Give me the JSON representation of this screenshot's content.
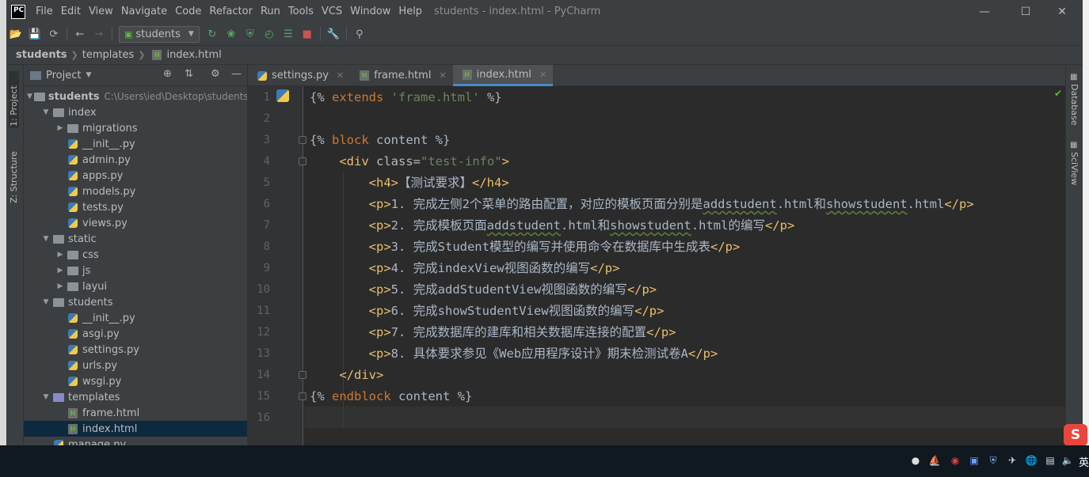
{
  "app": {
    "logo": "PC",
    "window_title": "students - index.html - PyCharm",
    "menu": [
      "File",
      "Edit",
      "View",
      "Navigate",
      "Code",
      "Refactor",
      "Run",
      "Tools",
      "VCS",
      "Window",
      "Help"
    ],
    "window_controls": {
      "minimize": "—",
      "maximize": "☐",
      "close": "✕"
    }
  },
  "toolbar": {
    "run_config": "students"
  },
  "breadcrumb": [
    "students",
    "templates",
    "index.html"
  ],
  "left_stripe": {
    "project_tab": "1: Project",
    "structure_tab": "Z: Structure"
  },
  "right_stripe": {
    "database_tab": "Database",
    "sciview_tab": "SciView"
  },
  "project_panel": {
    "title": "Project",
    "tree": [
      {
        "label": "students",
        "path": "C:\\Users\\ied\\Desktop\\students",
        "type": "folder",
        "depth": 0,
        "expanded": true,
        "bold": true
      },
      {
        "label": "index",
        "type": "folder",
        "depth": 1,
        "expanded": true
      },
      {
        "label": "migrations",
        "type": "folder",
        "depth": 2,
        "expanded": false
      },
      {
        "label": "__init__.py",
        "type": "py",
        "depth": 2
      },
      {
        "label": "admin.py",
        "type": "py",
        "depth": 2
      },
      {
        "label": "apps.py",
        "type": "py",
        "depth": 2
      },
      {
        "label": "models.py",
        "type": "py",
        "depth": 2
      },
      {
        "label": "tests.py",
        "type": "py",
        "depth": 2
      },
      {
        "label": "views.py",
        "type": "py",
        "depth": 2
      },
      {
        "label": "static",
        "type": "folder",
        "depth": 1,
        "expanded": true
      },
      {
        "label": "css",
        "type": "folder",
        "depth": 2,
        "expanded": false
      },
      {
        "label": "js",
        "type": "folder",
        "depth": 2,
        "expanded": false
      },
      {
        "label": "layui",
        "type": "folder",
        "depth": 2,
        "expanded": false
      },
      {
        "label": "students",
        "type": "folder",
        "depth": 1,
        "expanded": true
      },
      {
        "label": "__init__.py",
        "type": "py",
        "depth": 2
      },
      {
        "label": "asgi.py",
        "type": "py",
        "depth": 2
      },
      {
        "label": "settings.py",
        "type": "py",
        "depth": 2
      },
      {
        "label": "urls.py",
        "type": "py",
        "depth": 2
      },
      {
        "label": "wsgi.py",
        "type": "py",
        "depth": 2
      },
      {
        "label": "templates",
        "type": "folder-blue",
        "depth": 1,
        "expanded": true
      },
      {
        "label": "frame.html",
        "type": "html",
        "depth": 2
      },
      {
        "label": "index.html",
        "type": "html",
        "depth": 2,
        "selected": true
      },
      {
        "label": "manage.py",
        "type": "py",
        "depth": 1
      }
    ]
  },
  "editor_tabs": [
    {
      "label": "settings.py",
      "type": "py",
      "active": false
    },
    {
      "label": "frame.html",
      "type": "html",
      "active": false
    },
    {
      "label": "index.html",
      "type": "html",
      "active": true
    }
  ],
  "editor": {
    "lines": [
      [
        [
          "{% ",
          "tx"
        ],
        [
          "extends ",
          "kw"
        ],
        [
          "'frame.html'",
          "str"
        ],
        [
          " %}",
          "tx"
        ]
      ],
      [],
      [
        [
          "{% ",
          "tx"
        ],
        [
          "block ",
          "kw"
        ],
        [
          "content",
          "tx"
        ],
        [
          " %}",
          "tx"
        ]
      ],
      [
        [
          "    ",
          "tx"
        ],
        [
          "<div ",
          "tag"
        ],
        [
          "class=",
          "attr"
        ],
        [
          "\"test-info\"",
          "str"
        ],
        [
          ">",
          "tag"
        ]
      ],
      [
        [
          "        ",
          "tx"
        ],
        [
          "<h4>",
          "tag"
        ],
        [
          "【测试要求】",
          "tx"
        ],
        [
          "</h4>",
          "tag"
        ]
      ],
      [
        [
          "        ",
          "tx"
        ],
        [
          "<p>",
          "tag"
        ],
        [
          "1. 完成左侧2个菜单的路由配置，对应的模板页面分别是",
          "tx"
        ],
        [
          "addstudent",
          "ul"
        ],
        [
          ".html和",
          "tx"
        ],
        [
          "showstudent",
          "ul"
        ],
        [
          ".html",
          "tx"
        ],
        [
          "</p>",
          "tag"
        ]
      ],
      [
        [
          "        ",
          "tx"
        ],
        [
          "<p>",
          "tag"
        ],
        [
          "2. 完成模板页面",
          "tx"
        ],
        [
          "addstudent",
          "ul"
        ],
        [
          ".html和",
          "tx"
        ],
        [
          "showstudent",
          "ul"
        ],
        [
          ".html的编写",
          "tx"
        ],
        [
          "</p>",
          "tag"
        ]
      ],
      [
        [
          "        ",
          "tx"
        ],
        [
          "<p>",
          "tag"
        ],
        [
          "3. 完成Student模型的编写并使用命令在数据库中生成表",
          "tx"
        ],
        [
          "</p>",
          "tag"
        ]
      ],
      [
        [
          "        ",
          "tx"
        ],
        [
          "<p>",
          "tag"
        ],
        [
          "4. 完成indexView视图函数的编写",
          "tx"
        ],
        [
          "</p>",
          "tag"
        ]
      ],
      [
        [
          "        ",
          "tx"
        ],
        [
          "<p>",
          "tag"
        ],
        [
          "5. 完成addStudentView视图函数的编写",
          "tx"
        ],
        [
          "</p>",
          "tag"
        ]
      ],
      [
        [
          "        ",
          "tx"
        ],
        [
          "<p>",
          "tag"
        ],
        [
          "6. 完成showStudentView视图函数的编写",
          "tx"
        ],
        [
          "</p>",
          "tag"
        ]
      ],
      [
        [
          "        ",
          "tx"
        ],
        [
          "<p>",
          "tag"
        ],
        [
          "7. 完成数据库的建库和相关数据库连接的配置",
          "tx"
        ],
        [
          "</p>",
          "tag"
        ]
      ],
      [
        [
          "        ",
          "tx"
        ],
        [
          "<p>",
          "tag"
        ],
        [
          "8. 具体要求参见《Web应用程序设计》期末检测试卷A",
          "tx"
        ],
        [
          "</p>",
          "tag"
        ]
      ],
      [
        [
          "    ",
          "tx"
        ],
        [
          "</div>",
          "tag"
        ]
      ],
      [
        [
          "{% ",
          "tx"
        ],
        [
          "endblock ",
          "kw"
        ],
        [
          "content",
          "tx"
        ],
        [
          " %}",
          "tx"
        ]
      ],
      []
    ]
  },
  "taskbar": {
    "ime": "英"
  },
  "sogou_badge": "S"
}
